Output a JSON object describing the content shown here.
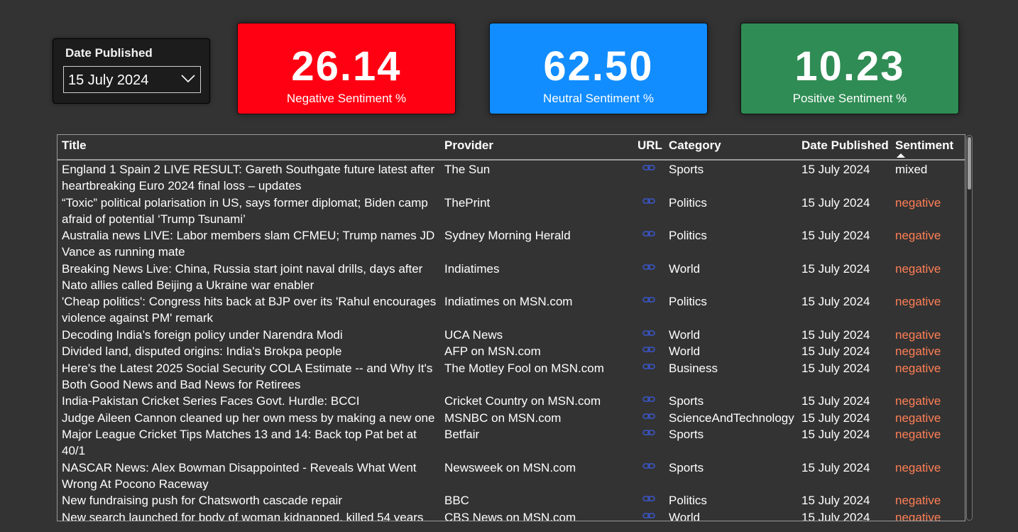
{
  "slicer": {
    "title": "Date Published",
    "value": "15 July 2024",
    "icon": "chevron-down-icon"
  },
  "kpis": {
    "negative": {
      "value": "26.14",
      "label": "Negative Sentiment %",
      "color": "#ff0013"
    },
    "neutral": {
      "value": "62.50",
      "label": "Neutral Sentiment %",
      "color": "#118dff"
    },
    "positive": {
      "value": "10.23",
      "label": "Positive Sentiment %",
      "color": "#2f8c54"
    }
  },
  "table": {
    "columns": {
      "title": "Title",
      "provider": "Provider",
      "url": "URL",
      "category": "Category",
      "date": "Date Published",
      "sentiment": "Sentiment"
    },
    "sort_indicator": "sort-ascending-icon",
    "url_icon": "link-icon",
    "negative_color": "#ff7f55",
    "rows": [
      {
        "title": "England 1 Spain 2 LIVE RESULT: Gareth Southgate future latest after heartbreaking Euro 2024 final loss – updates",
        "provider": "The Sun",
        "category": "Sports",
        "date": "15 July 2024",
        "sentiment": "mixed"
      },
      {
        "title": "“Toxic” political polarisation in US, says former diplomat; Biden camp afraid of potential ‘Trump Tsunami’",
        "provider": "ThePrint",
        "category": "Politics",
        "date": "15 July 2024",
        "sentiment": "negative"
      },
      {
        "title": "Australia news LIVE: Labor members slam CFMEU; Trump names JD Vance as running mate",
        "provider": "Sydney Morning Herald",
        "category": "Politics",
        "date": "15 July 2024",
        "sentiment": "negative"
      },
      {
        "title": "Breaking News Live: China, Russia start joint naval drills, days after Nato allies called Beijing a Ukraine war enabler",
        "provider": "Indiatimes",
        "category": "World",
        "date": "15 July 2024",
        "sentiment": "negative"
      },
      {
        "title": "'Cheap politics': Congress hits back at BJP over its 'Rahul encourages violence against PM' remark",
        "provider": "Indiatimes on MSN.com",
        "category": "Politics",
        "date": "15 July 2024",
        "sentiment": "negative"
      },
      {
        "title": "Decoding India’s foreign policy under Narendra Modi",
        "provider": "UCA News",
        "category": "World",
        "date": "15 July 2024",
        "sentiment": "negative"
      },
      {
        "title": "Divided land, disputed origins: India's Brokpa people",
        "provider": "AFP on MSN.com",
        "category": "World",
        "date": "15 July 2024",
        "sentiment": "negative"
      },
      {
        "title": "Here's the Latest 2025 Social Security COLA Estimate -- and Why It's Both Good News and Bad News for Retirees",
        "provider": "The Motley Fool on MSN.com",
        "category": "Business",
        "date": "15 July 2024",
        "sentiment": "negative"
      },
      {
        "title": "India-Pakistan Cricket Series Faces Govt. Hurdle: BCCI",
        "provider": "Cricket Country on MSN.com",
        "category": "Sports",
        "date": "15 July 2024",
        "sentiment": "negative"
      },
      {
        "title": "Judge Aileen Cannon cleaned up her own mess by making a new one",
        "provider": "MSNBC on MSN.com",
        "category": "ScienceAndTechnology",
        "date": "15 July 2024",
        "sentiment": "negative"
      },
      {
        "title": "Major League Cricket Tips Matches 13 and 14: Back top Pat bet at 40/1",
        "provider": "Betfair",
        "category": "Sports",
        "date": "15 July 2024",
        "sentiment": "negative"
      },
      {
        "title": "NASCAR News: Alex Bowman Disappointed - Reveals What Went Wrong At Pocono Raceway",
        "provider": "Newsweek on MSN.com",
        "category": "Sports",
        "date": "15 July 2024",
        "sentiment": "negative"
      },
      {
        "title": "New fundraising push for Chatsworth cascade repair",
        "provider": "BBC",
        "category": "Politics",
        "date": "15 July 2024",
        "sentiment": "negative"
      },
      {
        "title": "New search launched for body of woman kidnapped, killed 54 years",
        "provider": "CBS News on MSN.com",
        "category": "World",
        "date": "15 July 2024",
        "sentiment": "negative"
      }
    ]
  }
}
